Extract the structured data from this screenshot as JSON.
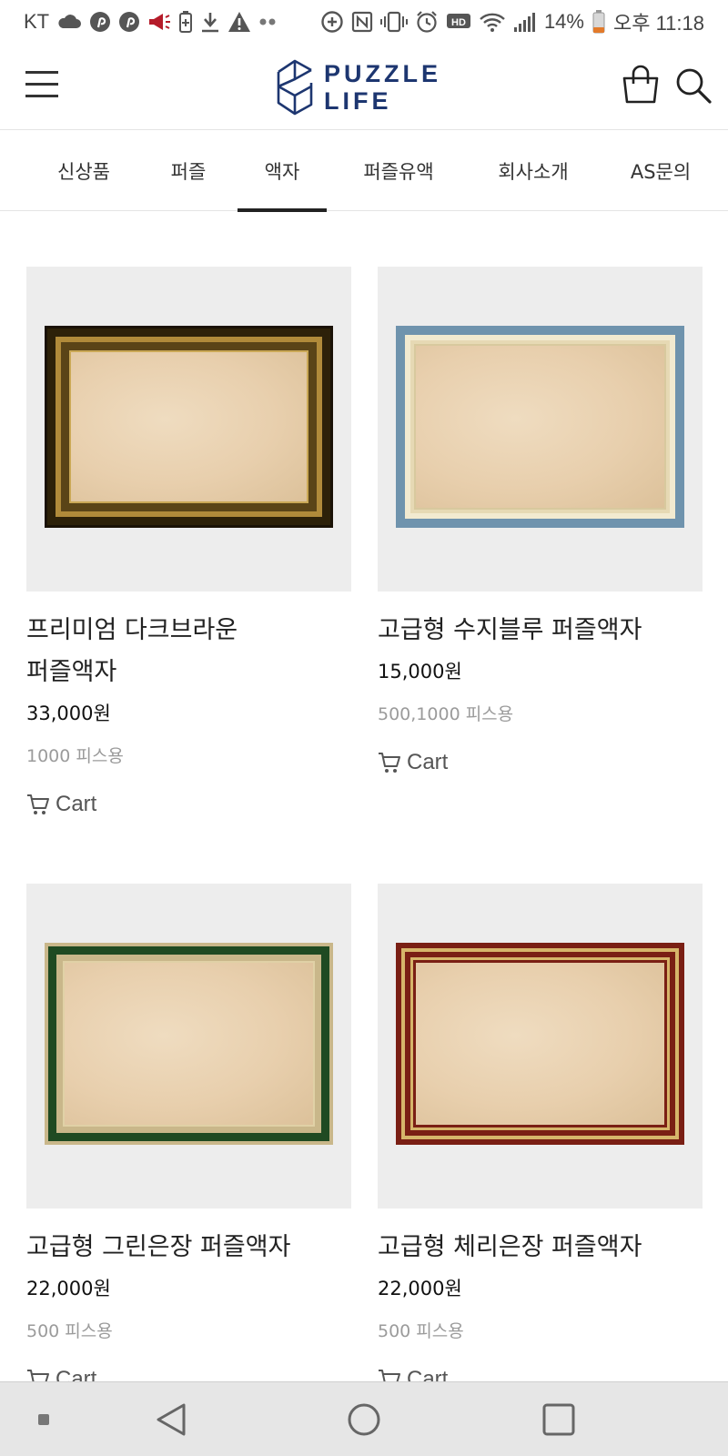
{
  "status_bar": {
    "carrier": "KT",
    "battery": "14%",
    "time": "오후 11:18",
    "icons": [
      "cloud-icon",
      "pinterest-icon",
      "pinterest-icon",
      "megaphone-icon",
      "battery-saver-icon",
      "download-icon",
      "warning-icon",
      "more-dots-icon",
      "data-saver-icon",
      "nfc-icon",
      "vibrate-icon",
      "alarm-icon",
      "hd-voice-icon",
      "wifi-icon",
      "signal-icon",
      "battery-icon"
    ]
  },
  "header": {
    "logo_line1": "PUZZLE",
    "logo_line2": "LIFE",
    "icons": [
      "menu-icon",
      "shopping-bag-icon",
      "search-icon"
    ]
  },
  "tabs": [
    {
      "label": "신상품"
    },
    {
      "label": "퍼즐"
    },
    {
      "label": "액자"
    },
    {
      "label": "퍼즐유액"
    },
    {
      "label": "회사소개"
    },
    {
      "label": "AS문의"
    }
  ],
  "active_tab": "액자",
  "products": [
    {
      "name_line1": "프리미엄 다크브라운",
      "name_line2": "퍼즐액자",
      "price": "33,000원",
      "note": "1000 피스용",
      "cart_label": "Cart",
      "frame_color": "#3a2b10",
      "frame_accent": "#b08a3a"
    },
    {
      "name_line1": "고급형 수지블루 퍼즐액자",
      "name_line2": "",
      "price": "15,000원",
      "note": "500,1000 피스용",
      "cart_label": "Cart",
      "frame_color": "#6f93ad",
      "frame_accent": "#f2ead0"
    },
    {
      "name_line1": "고급형 그린은장 퍼즐액자",
      "name_line2": "",
      "price": "22,000원",
      "note": "500 피스용",
      "cart_label": "Cart",
      "frame_color": "#1f4a22",
      "frame_accent": "#c9b78a"
    },
    {
      "name_line1": "고급형 체리은장 퍼즐액자",
      "name_line2": "",
      "price": "22,000원",
      "note": "500 피스용",
      "cart_label": "Cart",
      "frame_color": "#7a1f14",
      "frame_accent": "#d6b56a"
    }
  ],
  "nav_bar": {
    "icons": [
      "recent-dot-icon",
      "back-icon",
      "home-icon",
      "recents-icon"
    ]
  }
}
